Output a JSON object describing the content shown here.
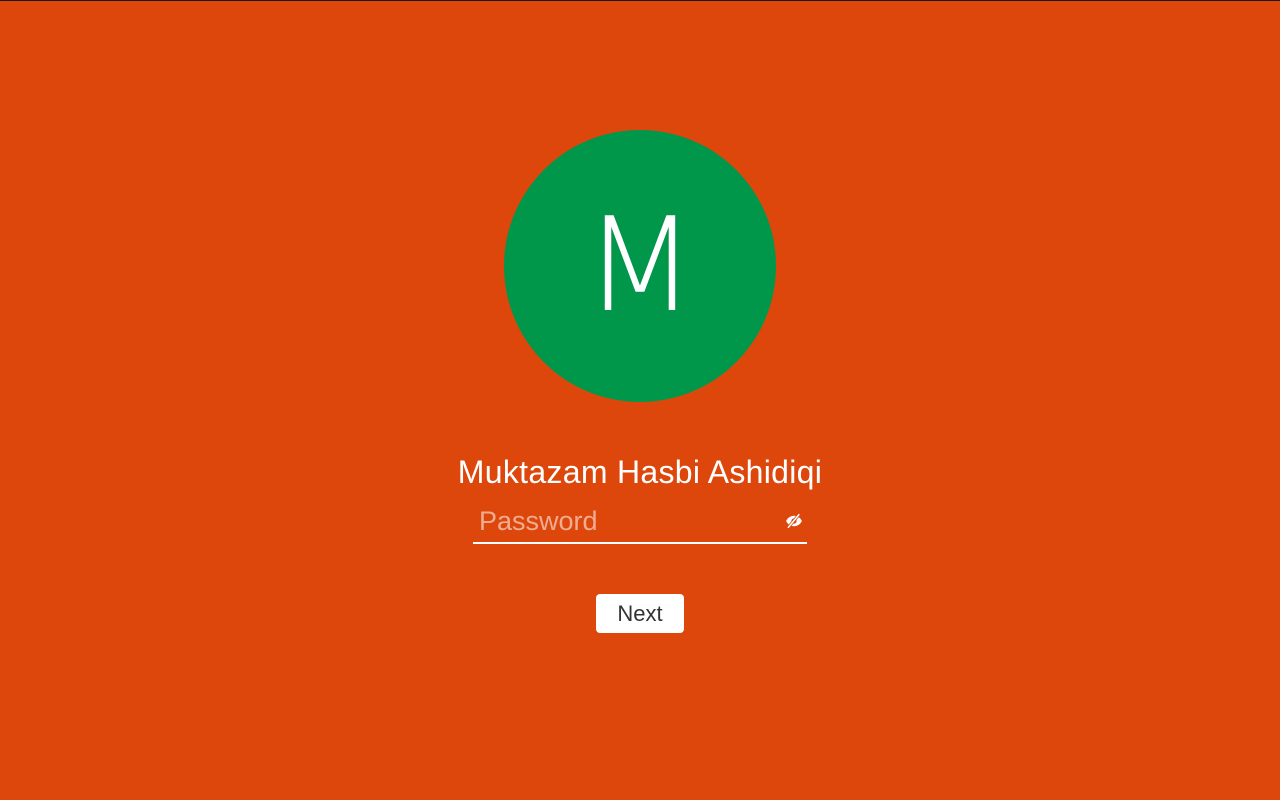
{
  "colors": {
    "background": "#DD470B",
    "avatar": "#00974B",
    "text": "#FFFFFF",
    "button_text": "#333333"
  },
  "user": {
    "avatar_letter": "M",
    "name": "Muktazam Hasbi Ashidiqi"
  },
  "password": {
    "value": "",
    "placeholder": "Password",
    "reveal_icon": "eye-off-icon"
  },
  "actions": {
    "next_label": "Next"
  }
}
